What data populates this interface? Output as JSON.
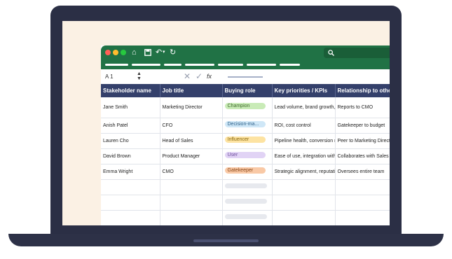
{
  "toolbar": {
    "window_controls": [
      "close",
      "minimize",
      "maximize"
    ],
    "icons": [
      "home-icon",
      "save-icon",
      "undo-icon",
      "redo-icon",
      "search-icon"
    ]
  },
  "formula_bar": {
    "cell_ref": "A 1",
    "stepper": "⌃⌄",
    "cancel": "✕",
    "confirm": "✓",
    "fx": "fx"
  },
  "table": {
    "headers": [
      "Stakeholder name",
      "Job title",
      "Buying role",
      "Key priorities / KPIs",
      "Relationship to others"
    ],
    "rows": [
      {
        "name": "Jane Smith",
        "title": "Marketing Director",
        "role": "Champion",
        "priorities": "Lead volume, brand growth, own professional development",
        "relationship": "Reports to CMO"
      },
      {
        "name": "Anish Patel",
        "title": "CFO",
        "role": "Decision-ma...",
        "priorities": "ROI, cost control",
        "relationship": "Gatekeeper to budget"
      },
      {
        "name": "Lauren Cho",
        "title": "Head of Sales",
        "role": "Influencer",
        "priorities": "Pipeline health, conversion rate",
        "relationship": "Peer to Marketing Director"
      },
      {
        "name": "David Brown",
        "title": "Product Manager",
        "role": "User",
        "priorities": "Ease of use, integration with other tools",
        "relationship": "Collaborates with Sales"
      },
      {
        "name": "Emma Wright",
        "title": "CMO",
        "role": "Gatekeeper",
        "priorities": "Strategic alignment, reputation",
        "relationship": "Oversees entire team"
      }
    ]
  },
  "colors": {
    "title_bar": "#207245",
    "header_bg": "#34406b",
    "champion": "#c9ebb7",
    "decision_maker": "#cfe7f7",
    "influencer": "#fde3a2",
    "user": "#e1d3f5",
    "gatekeeper": "#f9c9a6"
  }
}
